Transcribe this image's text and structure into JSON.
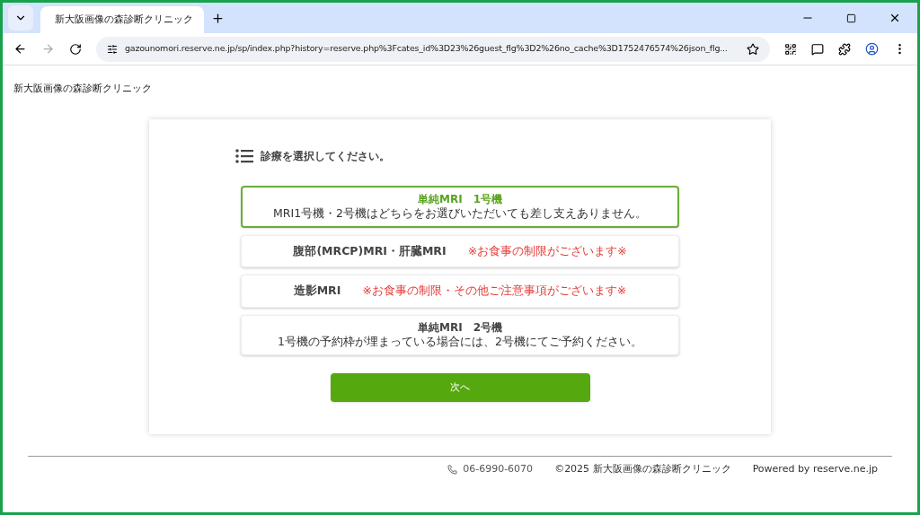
{
  "browser": {
    "tab_title": "新大阪画像の森診断クリニック",
    "url": "gazounomori.reserve.ne.jp/sp/index.php?history=reserve.php%3Fcates_id%3D23%26guest_flg%3D2%26no_cache%3D1752476574%26json_flg..."
  },
  "site_title": "新大阪画像の森診断クリニック",
  "heading": "診療を選択してください。",
  "options": [
    {
      "kind": "subline",
      "title": "単純MRI　1号機",
      "note": "MRI1号機・2号機はどちらをお選びいただいても差し支えありません。",
      "selected": true
    },
    {
      "kind": "inline",
      "title": "腹部(MRCP)MRI・肝臓MRI",
      "note": "※お食事の制限がございます※",
      "selected": false
    },
    {
      "kind": "inline",
      "title": "造影MRI",
      "note": "※お食事の制限・その他ご注意事項がございます※",
      "selected": false
    },
    {
      "kind": "subline",
      "title": "単純MRI　2号機",
      "note": "1号機の予約枠が埋まっている場合には、2号機にてご予約ください。",
      "selected": false
    }
  ],
  "next_button": "次へ",
  "footer": {
    "phone": "06-6990-6070",
    "copyright": "©2025 新大阪画像の森診断クリニック",
    "powered": "Powered by reserve.ne.jp"
  }
}
